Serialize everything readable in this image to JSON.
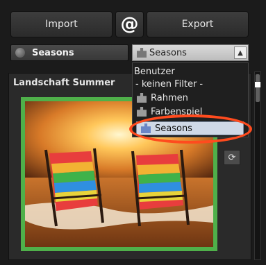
{
  "toolbar": {
    "import_label": "Import",
    "at_label": "@",
    "export_label": "Export"
  },
  "preset": {
    "name": "Seasons"
  },
  "filter_dropdown": {
    "selected": "Seasons",
    "arrow": "▲",
    "items": [
      "Benutzer",
      "- keinen Filter -",
      "Rahmen",
      "Farbenspiel",
      "Seasons"
    ]
  },
  "panel": {
    "title": "Landschaft Summer"
  },
  "icons": {
    "refresh": "⟳",
    "puzzle": "puzzle-icon"
  },
  "colors": {
    "frame": "#4fb04a",
    "highlight": "#ff4b1e"
  }
}
